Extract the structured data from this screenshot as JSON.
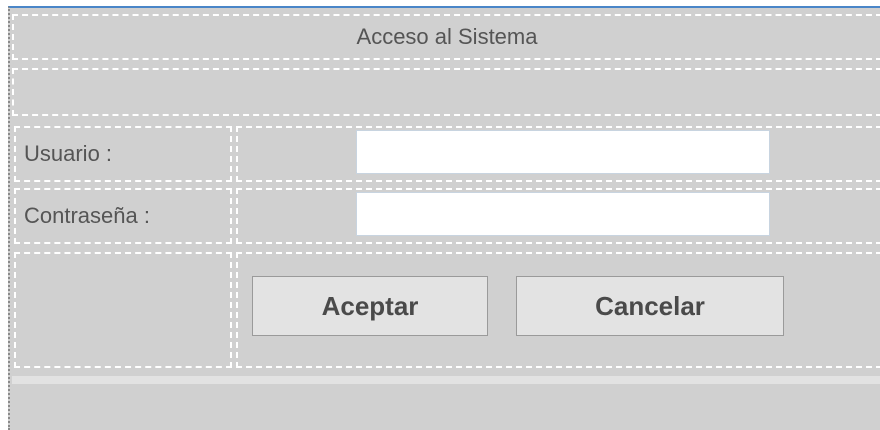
{
  "login": {
    "title": "Acceso al Sistema",
    "message": "",
    "username_label": "Usuario :",
    "username_value": "",
    "password_label": "Contraseña :",
    "password_value": "",
    "accept_label": "Aceptar",
    "cancel_label": "Cancelar"
  },
  "colors": {
    "background": "#d0d0d0",
    "button_bg": "#e3e3e3",
    "text": "#555555",
    "accent_border": "#4a86c8"
  }
}
